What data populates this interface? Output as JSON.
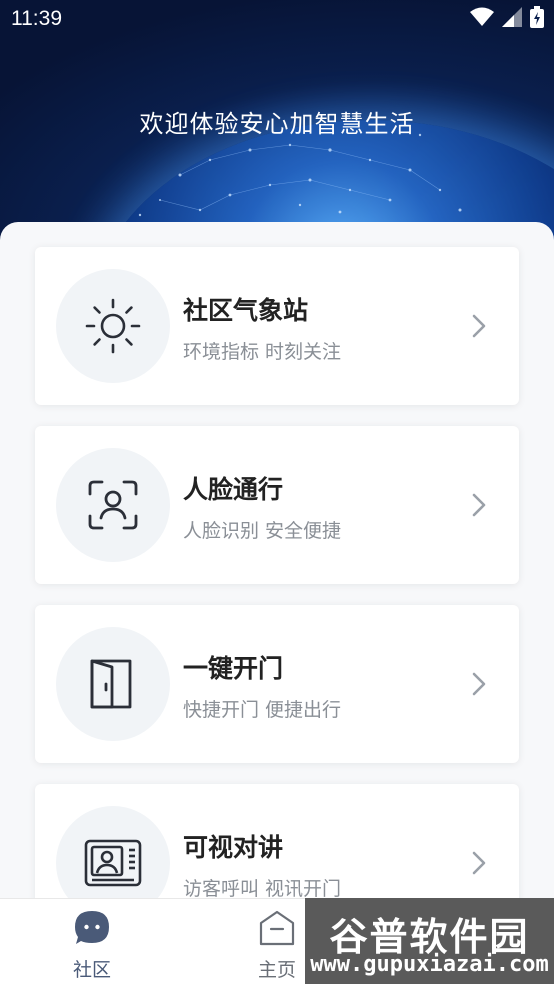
{
  "status_bar": {
    "time": "11:39"
  },
  "hero": {
    "welcome_text": "欢迎体验安心加智慧生活"
  },
  "cards": [
    {
      "title": "社区气象站",
      "subtitle": "环境指标 时刻关注",
      "icon": "sun-icon"
    },
    {
      "title": "人脸通行",
      "subtitle": "人脸识别 安全便捷",
      "icon": "face-scan-icon"
    },
    {
      "title": "一键开门",
      "subtitle": "快捷开门 便捷出行",
      "icon": "door-icon"
    },
    {
      "title": "可视对讲",
      "subtitle": "访客呼叫 视讯开门",
      "icon": "video-intercom-icon"
    }
  ],
  "tabbar": {
    "items": [
      {
        "label": "社区",
        "icon": "chat-bubble-icon",
        "active": true
      },
      {
        "label": "主页",
        "icon": "home-icon",
        "active": false
      }
    ]
  },
  "watermark": {
    "title": "谷普软件园",
    "url": "www.gupuxiazai.com"
  },
  "colors": {
    "active_tab": "#4a5a78",
    "inactive_tab": "#8a8f96",
    "card_title": "#222222",
    "card_subtitle": "#8a8f96"
  }
}
